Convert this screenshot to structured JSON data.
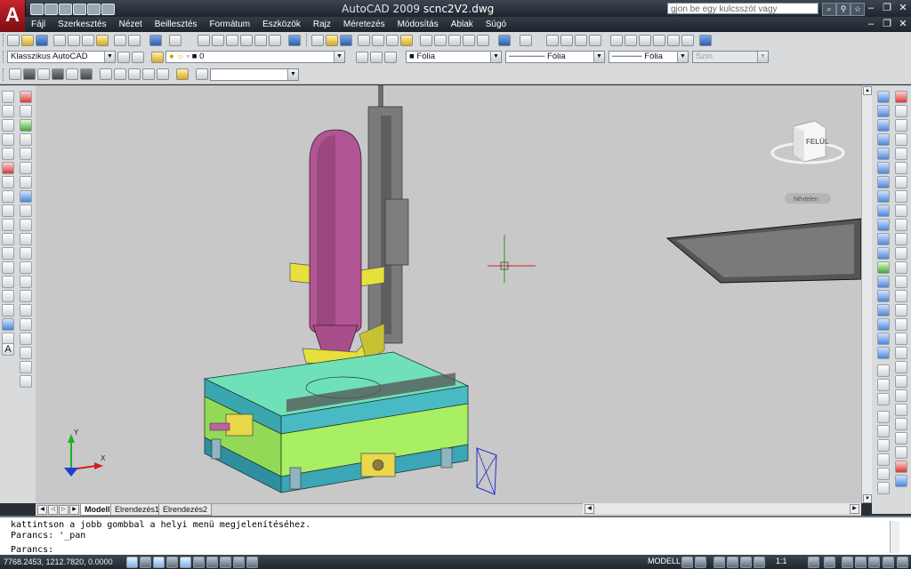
{
  "titlebar": {
    "app_name": "AutoCAD 2009",
    "file_name": "scnc2V2.dwg",
    "search_placeholder": "gjon be egy kulcsszót vagy kifejezést",
    "logo_letter": "A"
  },
  "menu": {
    "items": [
      "Fájl",
      "Szerkesztés",
      "Nézet",
      "Beillesztés",
      "Formátum",
      "Eszközök",
      "Rajz",
      "Méretezés",
      "Módosítás",
      "Ablak",
      "Súgó"
    ]
  },
  "properties_bar": {
    "workspace": "Klasszikus AutoCAD",
    "layer": "0",
    "color": "Fólia",
    "linetype": "Fólia",
    "lineweight": "Fólia",
    "plotstyle": "Szín"
  },
  "viewcube": {
    "face_label": "FELÜL",
    "view_menu": "Névtelen"
  },
  "ucs": {
    "x_label": "X",
    "y_label": "Y"
  },
  "tabs": [
    "Modell",
    "Elrendezés1",
    "Elrendezés2"
  ],
  "active_tab": "Modell",
  "command": {
    "history": [
      "kattintson a jobb gombbal a helyi menü megjelenítéséhez.",
      "Parancs: '_pan"
    ],
    "prompt": "Parancs:"
  },
  "status": {
    "coordinates": "7768.2453, 1212.7820, 0.0000",
    "model_label": "MODELL",
    "annotation_scale": "1:1"
  },
  "colors": {
    "viewport_bg": "#c8c8c8",
    "titlebar": "#1f252c",
    "table_top": "#6fe0b8",
    "body_green": "#a8ef63",
    "tank": "#b0508f",
    "bracket": "#e8e040"
  }
}
